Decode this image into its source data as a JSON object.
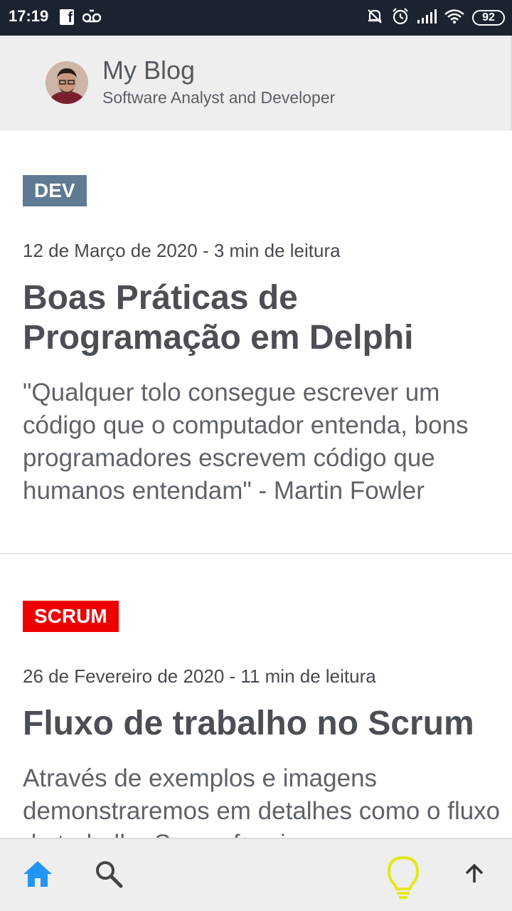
{
  "status_bar": {
    "time": "17:19",
    "battery": "92",
    "icons": [
      "facebook-icon",
      "voicemail-icon",
      "silent-bell-icon",
      "alarm-icon",
      "signal-icon",
      "wifi-icon",
      "battery-icon"
    ]
  },
  "header": {
    "title": "My Blog",
    "subtitle": "Software Analyst and Developer"
  },
  "posts": [
    {
      "tag": "DEV",
      "tag_color": "#5f7a93",
      "meta": "12 de Março de 2020 - 3 min de leitura",
      "title": "Boas Práticas de Programação em Delphi",
      "excerpt": "\"Qualquer tolo consegue escrever um código que o computador entenda, bons programadores escrevem código que humanos entendam\" - Martin Fowler"
    },
    {
      "tag": "SCRUM",
      "tag_color": "#ee0000",
      "meta": "26 de Fevereiro de 2020 - 11 min de leitura",
      "title": "Fluxo de trabalho no Scrum",
      "excerpt": "Através de exemplos e imagens demonstraremos em detalhes como o fluxo de trabalho Scrum funciona"
    }
  ],
  "bottom_bar": {
    "icons": [
      "home-icon",
      "search-icon",
      "lightbulb-icon",
      "arrow-up-icon"
    ],
    "accent_color": "#2196f3",
    "bulb_color": "#e6e61a"
  }
}
